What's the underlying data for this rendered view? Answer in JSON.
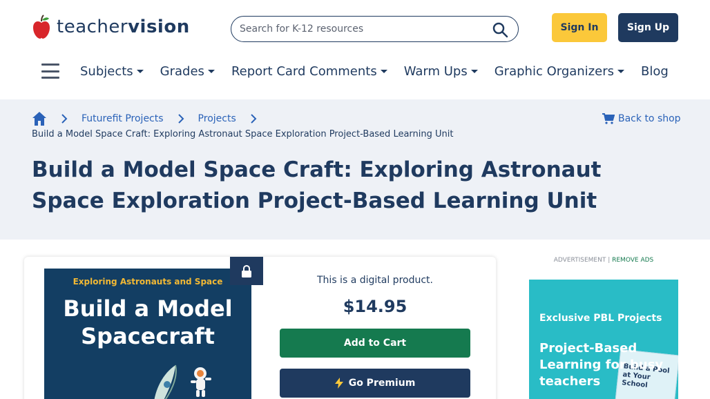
{
  "header": {
    "logo_word_light": "teacher",
    "logo_word_bold": "vision",
    "search_placeholder": "Search for K-12 resources",
    "signin_label": "Sign In",
    "signup_label": "Sign Up"
  },
  "nav": {
    "items": [
      {
        "label": "Subjects",
        "has_menu": true
      },
      {
        "label": "Grades",
        "has_menu": true
      },
      {
        "label": "Report Card Comments",
        "has_menu": true
      },
      {
        "label": "Warm Ups",
        "has_menu": true
      },
      {
        "label": "Graphic Organizers",
        "has_menu": true
      },
      {
        "label": "Blog",
        "has_menu": false
      }
    ]
  },
  "breadcrumb": {
    "items": [
      "Futurefit Projects",
      "Projects"
    ],
    "current": "Build a Model Space Craft: Exploring Astronaut Space Exploration Project-Based Learning Unit",
    "back_label": "Back to shop"
  },
  "page": {
    "title": "Build a Model Space Craft: Exploring Astronaut Space Exploration Project-Based Learning Unit"
  },
  "product": {
    "cover_kicker": "Exploring Astronauts and Space",
    "cover_title": "Build a Model Spacecraft",
    "digital_note": "This is a digital product.",
    "price": "$14.95",
    "add_to_cart_label": "Add to Cart",
    "premium_label": "Go Premium"
  },
  "ad": {
    "label": "ADVERTISEMENT |",
    "remove_label": "REMOVE ADS",
    "kicker": "Exclusive PBL Projects",
    "headline": "Project-Based Learning for busy teachers",
    "book_title": "Build a Pool at Your School"
  },
  "colors": {
    "navy": "#1f3a5f",
    "accent_yellow": "#fbc83a",
    "link_blue": "#2a62b8",
    "cart_green": "#157a4f",
    "hero_bg": "#eef1f6",
    "ad_teal": "#29bcc6"
  }
}
